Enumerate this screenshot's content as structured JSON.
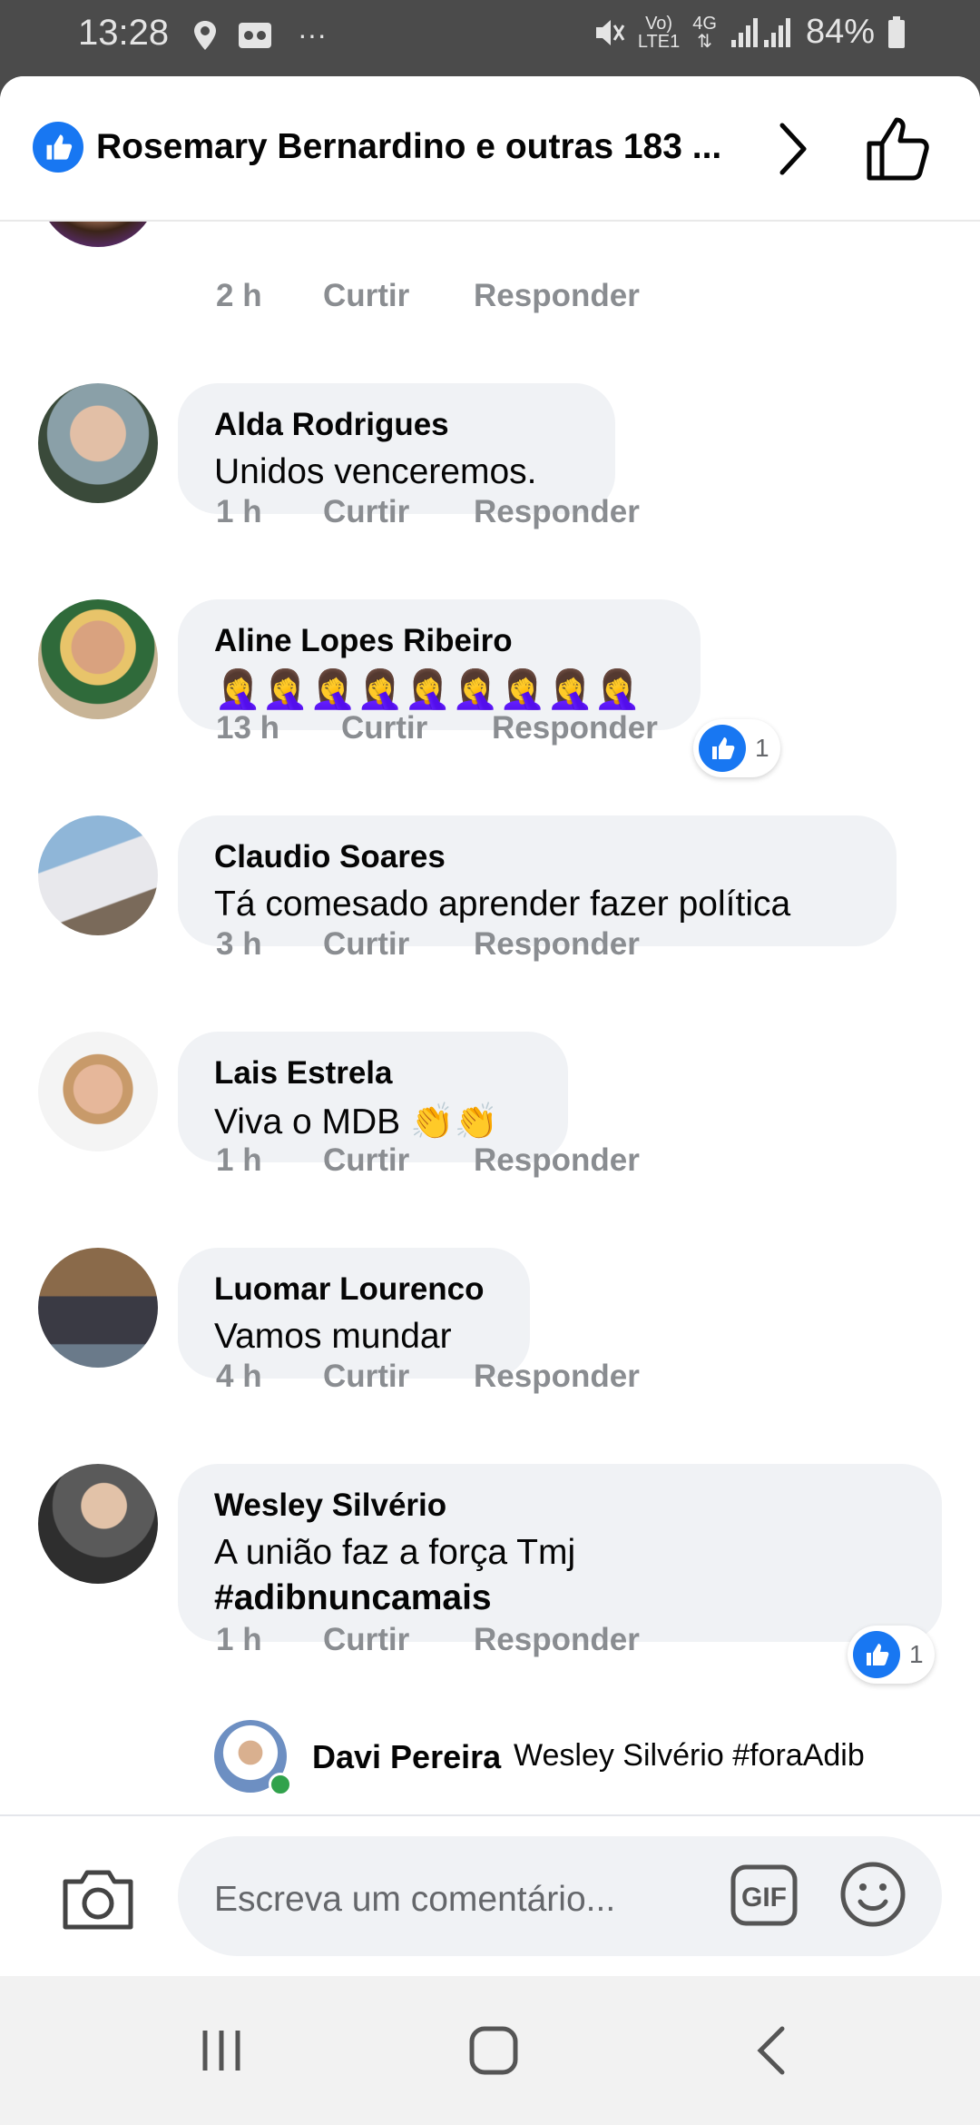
{
  "status_bar": {
    "time": "13:28",
    "network_top": "Vo)",
    "network_bottom": "LTE1",
    "net_type": "4G",
    "battery": "84%"
  },
  "header": {
    "title": "Rosemary Bernardino e outras 183 ...",
    "icons": [
      "like-badge-icon",
      "chevron-right-icon",
      "thumbs-up-icon"
    ]
  },
  "comments": [
    {
      "name": "",
      "emoji": "👏👏👏👏👏",
      "time": "2 h",
      "like": "Curtir",
      "reply": "Responder"
    },
    {
      "name": "Alda Rodrigues",
      "text": "Unidos venceremos.",
      "time": "1 h",
      "like": "Curtir",
      "reply": "Responder"
    },
    {
      "name": "Aline Lopes Ribeiro",
      "emoji": "🤦‍♀️🤦‍♀️🤦‍♀️🤦‍♀️🤦‍♀️🤦‍♀️🤦‍♀️🤦‍♀️🤦‍♀️",
      "time": "13 h",
      "like": "Curtir",
      "reply": "Responder",
      "reactions": "1"
    },
    {
      "name": "Claudio Soares",
      "text": "Tá comesado aprender fazer política",
      "time": "3 h",
      "like": "Curtir",
      "reply": "Responder"
    },
    {
      "name": "Lais Estrela",
      "text": "Viva o MDB 👏👏",
      "time": "1 h",
      "like": "Curtir",
      "reply": "Responder"
    },
    {
      "name": "Luomar Lourenco",
      "text": "Vamos mundar",
      "time": "4 h",
      "like": "Curtir",
      "reply": "Responder"
    },
    {
      "name": "Wesley Silvério",
      "text": "A união faz a força Tmj",
      "hashtag": "#adibnuncamais",
      "time": "1 h",
      "like": "Curtir",
      "reply": "Responder",
      "reactions": "1"
    }
  ],
  "reply_preview": {
    "name": "Davi Pereira",
    "text": "Wesley Silvério #foraAdib"
  },
  "composer": {
    "placeholder": "Escreva um comentário...",
    "gif_label": "GIF"
  },
  "colors": {
    "accent": "#1877f2",
    "bubble": "#f0f2f5",
    "meta": "#8a8d91",
    "status_bar": "#4b4b4b"
  }
}
